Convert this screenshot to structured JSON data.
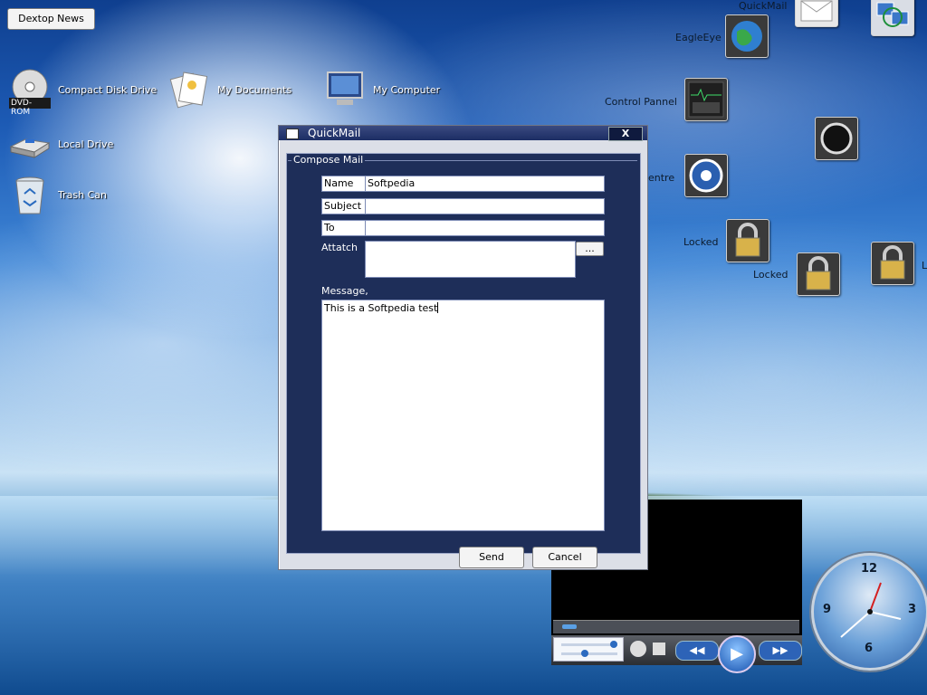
{
  "desktop": {
    "news_button": "Dextop News",
    "icons": [
      {
        "label": "Compact Disk Drive",
        "badge": "DVD-ROM",
        "icon": "dvd-rom-icon"
      },
      {
        "label": "My Documents",
        "icon": "my-documents-icon"
      },
      {
        "label": "My Computer",
        "icon": "my-computer-icon"
      },
      {
        "label": "Local Drive",
        "icon": "local-drive-icon"
      },
      {
        "label": "Trash Can",
        "icon": "trash-can-icon"
      }
    ],
    "launchers": [
      {
        "label": "QuickMail",
        "icon": "quickmail-icon"
      },
      {
        "label": "EagleEye",
        "icon": "eagleeye-globe-icon"
      },
      {
        "label": "Control Pannel",
        "icon": "control-panel-icon"
      },
      {
        "label": "entre",
        "icon": "centre-icon"
      },
      {
        "label": "Locked",
        "icon": "locked-icon"
      },
      {
        "label": "Locked",
        "icon": "locked-icon"
      },
      {
        "label": "L",
        "icon": "locked-icon"
      }
    ]
  },
  "window": {
    "title": "QuickMail",
    "close_label": "X",
    "group_label": "Compose Mail",
    "fields": {
      "name_label": "Name",
      "name_value": "Softpedia",
      "subject_label": "Subject",
      "subject_value": "",
      "to_label": "To",
      "to_value": "",
      "attach_label": "Attatch",
      "browse_label": "...",
      "message_label": "Message,",
      "message_value": "This is a Softpedia test"
    },
    "send_label": "Send",
    "cancel_label": "Cancel"
  },
  "media_player": {
    "seek_progress": 0.05
  },
  "clock": {
    "numbers": [
      "12",
      "3",
      "6",
      "9"
    ]
  },
  "colors": {
    "window_frame": "#1e2e59",
    "title_bar": "#1c2d64"
  }
}
